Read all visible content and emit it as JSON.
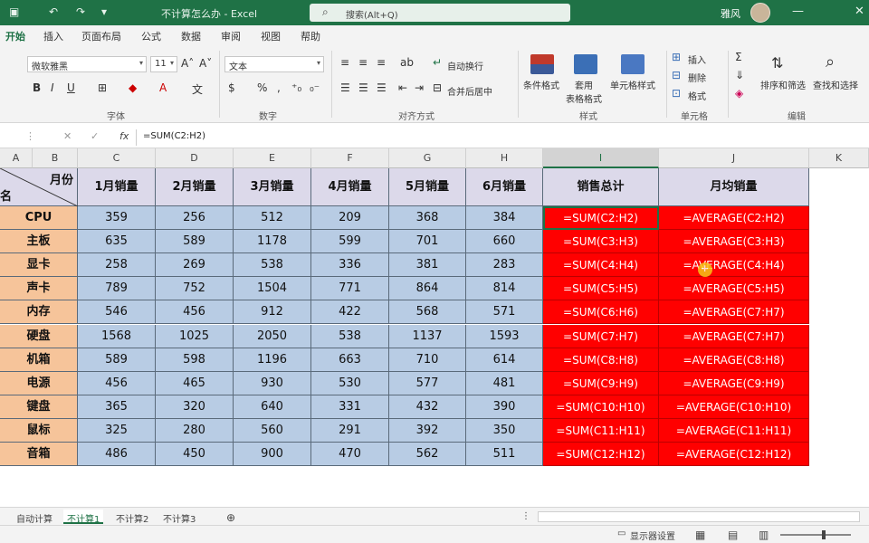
{
  "titlebar": {
    "title": "不计算怎么办 - Excel",
    "search_placeholder": "搜索(Alt+Q)",
    "user": "雅风",
    "icons": [
      "save-icon",
      "undo-icon",
      "redo-icon",
      "customize-icon"
    ]
  },
  "tabs": [
    "开始",
    "插入",
    "页面布局",
    "公式",
    "数据",
    "审阅",
    "视图",
    "帮助"
  ],
  "ribbon": {
    "font_name": "微软雅黑",
    "font_size": "11",
    "number_format": "文本",
    "wrap_text": "自动换行",
    "merge_center": "合并后居中",
    "conditional_format": "条件格式",
    "table_format": "套用\n表格格式",
    "cell_style": "单元格样式",
    "insert": "插入",
    "delete": "删除",
    "format": "格式",
    "sort_filter": "排序和筛选",
    "find_select": "查找和选择",
    "groups": {
      "font": "字体",
      "number": "数字",
      "alignment": "对齐方式",
      "styles": "样式",
      "cells": "单元格",
      "editing": "编辑"
    },
    "font_buttons": [
      "B",
      "I",
      "U"
    ],
    "number_buttons": [
      "%",
      ","
    ]
  },
  "formula_bar": {
    "fx": "fx",
    "formula": "=SUM(C2:H2)"
  },
  "grid": {
    "col_letters": [
      "A",
      "B",
      "C",
      "D",
      "E",
      "F",
      "G",
      "H",
      "I",
      "J",
      "K"
    ],
    "header_corner_top": "月份",
    "header_corner_bottom": "名",
    "headers": [
      "1月销量",
      "2月销量",
      "3月销量",
      "4月销量",
      "5月销量",
      "6月销量",
      "销售总计",
      "月均销量"
    ],
    "rows": [
      {
        "name": "CPU",
        "values": [
          359,
          256,
          512,
          209,
          368,
          384
        ],
        "sum": "=SUM(C2:H2)",
        "avg": "=AVERAGE(C2:H2)"
      },
      {
        "name": "主板",
        "values": [
          635,
          589,
          1178,
          599,
          701,
          660
        ],
        "sum": "=SUM(C3:H3)",
        "avg": "=AVERAGE(C3:H3)"
      },
      {
        "name": "显卡",
        "values": [
          258,
          269,
          538,
          336,
          381,
          283
        ],
        "sum": "=SUM(C4:H4)",
        "avg": "=AVERAGE(C4:H4)"
      },
      {
        "name": "声卡",
        "values": [
          789,
          752,
          1504,
          771,
          864,
          814
        ],
        "sum": "=SUM(C5:H5)",
        "avg": "=AVERAGE(C5:H5)"
      },
      {
        "name": "内存",
        "values": [
          546,
          456,
          912,
          422,
          568,
          571
        ],
        "sum": "=SUM(C6:H6)",
        "avg": "=AVERAGE(C7:H7)"
      },
      {
        "name": "硬盘",
        "values": [
          1568,
          1025,
          2050,
          538,
          1137,
          1593
        ],
        "sum": "=SUM(C7:H7)",
        "avg": "=AVERAGE(C7:H7)"
      },
      {
        "name": "机箱",
        "values": [
          589,
          598,
          1196,
          663,
          710,
          614
        ],
        "sum": "=SUM(C8:H8)",
        "avg": "=AVERAGE(C8:H8)"
      },
      {
        "name": "电源",
        "values": [
          456,
          465,
          930,
          530,
          577,
          481
        ],
        "sum": "=SUM(C9:H9)",
        "avg": "=AVERAGE(C9:H9)"
      },
      {
        "name": "键盘",
        "values": [
          365,
          320,
          640,
          331,
          432,
          390
        ],
        "sum": "=SUM(C10:H10)",
        "avg": "=AVERAGE(C10:H10)"
      },
      {
        "name": "鼠标",
        "values": [
          325,
          280,
          560,
          291,
          392,
          350
        ],
        "sum": "=SUM(C11:H11)",
        "avg": "=AVERAGE(C11:H11)"
      },
      {
        "name": "音箱",
        "values": [
          486,
          450,
          900,
          470,
          562,
          511
        ],
        "sum": "=SUM(C12:H12)",
        "avg": "=AVERAGE(C12:H12)"
      }
    ]
  },
  "sheets": [
    "自动计算",
    "不计算1",
    "不计算2",
    "不计算3"
  ],
  "active_sheet": "不计算1",
  "status": {
    "display_settings": "显示器设置"
  },
  "colors": {
    "excel_green": "#1f7246",
    "header_fill": "#dcd9ea",
    "row_label_fill": "#f6c49a",
    "data_fill": "#b8cce4",
    "formula_fill": "#ff0000"
  }
}
